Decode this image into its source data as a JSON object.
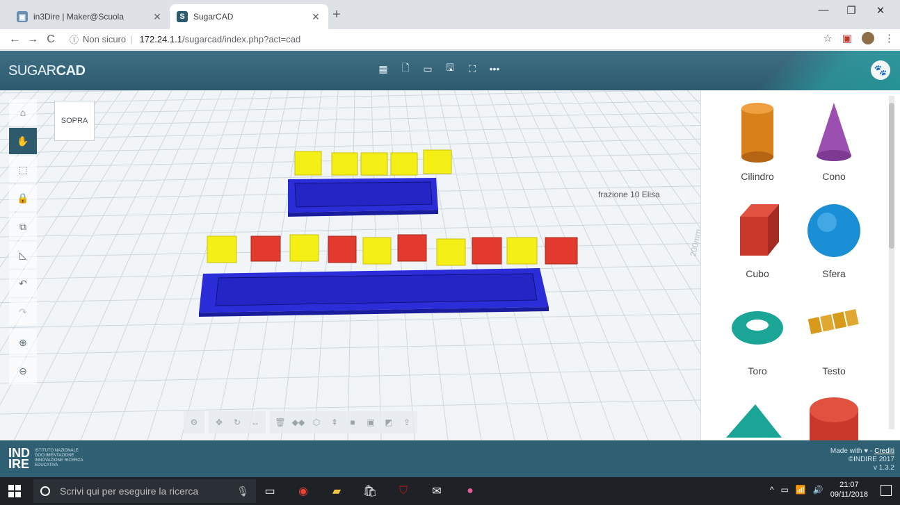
{
  "browser": {
    "tabs": [
      {
        "title": "in3Dire | Maker@Scuola",
        "favicon": "image-favicon",
        "active": false
      },
      {
        "title": "SugarCAD",
        "favicon": "S",
        "active": true
      }
    ],
    "new_tab": "+",
    "address": {
      "security": "Non sicuro",
      "host": "172.24.1.1",
      "path": "/sugarcad/index.php?act=cad"
    }
  },
  "app": {
    "logo_light": "SUGAR",
    "logo_bold": "CAD",
    "toolbar_icons": [
      "calculator-icon",
      "new-file-icon",
      "folder-icon",
      "save-icon",
      "fullscreen-icon",
      "more-icon"
    ],
    "filename": "frazione 10 Elisa",
    "viewcube_label": "SOPRA",
    "left_tools": [
      "home-icon",
      "pan-hand-icon",
      "select-box-icon",
      "lock-icon",
      "duplicate-icon",
      "ruler-icon",
      "undo-icon",
      "redo-icon",
      "zoom-in-icon",
      "zoom-out-icon"
    ],
    "ruler_label": "200mm"
  },
  "shapes": [
    {
      "name": "Cilindro",
      "color": "#d8801a"
    },
    {
      "name": "Cono",
      "color": "#9b4fb0"
    },
    {
      "name": "Cubo",
      "color": "#c8382b"
    },
    {
      "name": "Sfera",
      "color": "#1a8fd6"
    },
    {
      "name": "Toro",
      "color": "#1aa596"
    },
    {
      "name": "Testo",
      "color": "#d89a1a"
    }
  ],
  "footer": {
    "logo": "IND\nIRE",
    "sub": "ISTITUTO NAZIONALE DOCUMENTAZIONE INNOVAZIONE RICERCA EDUCATIVA",
    "made_with": "Made with",
    "credits": "Crediti",
    "copyright": "©INDIRE 2017",
    "version": "v 1.3.2"
  },
  "taskbar": {
    "search_placeholder": "Scrivi qui per eseguire la ricerca",
    "time": "21:07",
    "date": "09/11/2018"
  },
  "colors": {
    "blue_block": "#2b2ed8",
    "yellow_block": "#f4ef16",
    "red_block": "#e23a2c",
    "header": "#2e5a6e"
  }
}
